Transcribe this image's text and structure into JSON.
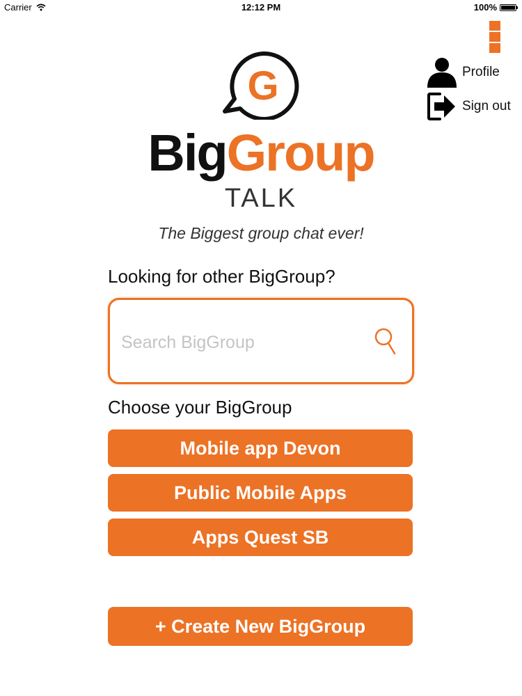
{
  "status_bar": {
    "carrier": "Carrier",
    "time": "12:12 PM",
    "battery": "100%"
  },
  "menu": {
    "profile_label": "Profile",
    "signout_label": "Sign out"
  },
  "logo": {
    "letter": "G",
    "word_big": "Big",
    "word_group": "Group",
    "word_talk": "TALK"
  },
  "tagline": "The Biggest group chat ever!",
  "search": {
    "label": "Looking for other BigGroup?",
    "placeholder": "Search BigGroup",
    "value": ""
  },
  "groups": {
    "label": "Choose your BigGroup",
    "items": [
      {
        "label": "Mobile app Devon"
      },
      {
        "label": "Public Mobile Apps"
      },
      {
        "label": "Apps Quest SB"
      }
    ]
  },
  "create_button_label": "+ Create New BigGroup",
  "colors": {
    "accent": "#EC7225",
    "text": "#111111",
    "placeholder": "#C4C4C4"
  }
}
